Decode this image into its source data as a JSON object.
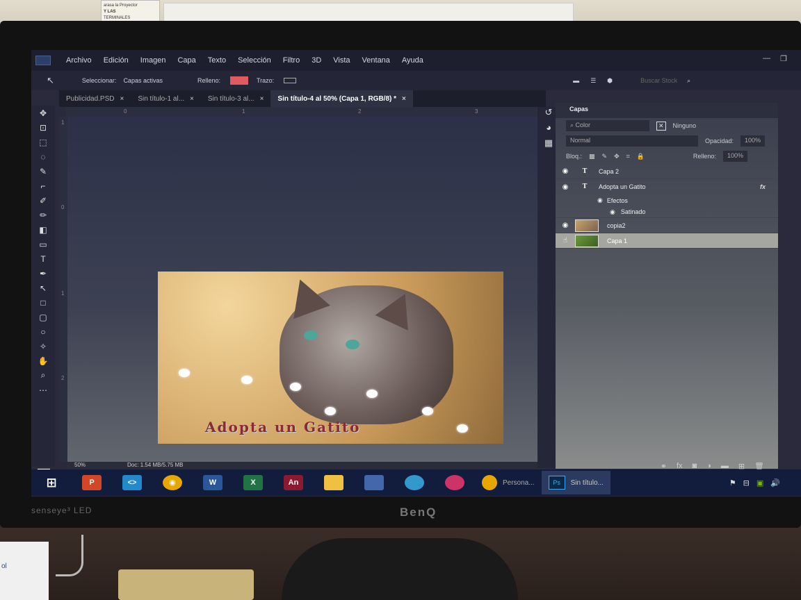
{
  "poster": {
    "line1": "arasa la Proyector",
    "line2": "Y LAS",
    "line3": "TERMINALES"
  },
  "menubar": {
    "items": [
      "Archivo",
      "Edición",
      "Imagen",
      "Capa",
      "Texto",
      "Selección",
      "Filtro",
      "3D",
      "Vista",
      "Ventana",
      "Ayuda"
    ]
  },
  "options": {
    "select_label": "Seleccionar:",
    "select_value": "Capas activas",
    "fill_label": "Relleno:",
    "fill_color": "#e05a60",
    "stroke_label": "Trazo:",
    "search_placeholder": "Buscar Stock"
  },
  "tabs": [
    {
      "label": "Publicidad.PSD"
    },
    {
      "label": "Sin título-1 al..."
    },
    {
      "label": "Sin título-3 al..."
    },
    {
      "label": "Sin título-4 al 50% (Capa 1, RGB/8) *",
      "active": true
    }
  ],
  "close_glyph": "×",
  "ruler": {
    "h": [
      "0",
      "1",
      "2",
      "3"
    ],
    "v": [
      "1",
      "0",
      "1",
      "2"
    ]
  },
  "canvas": {
    "image_text": "Adopta un Gatito"
  },
  "status": {
    "zoom": "50%",
    "doc": "Doc: 1.54 MB/5.75 MB"
  },
  "layers_panel": {
    "title": "Capas",
    "filter_placeholder": "Color",
    "filter_none": "Ninguno",
    "blend_mode": "Normal",
    "opacity_label": "Opacidad:",
    "opacity_value": "100%",
    "lock_label": "Bloq.:",
    "fill_label": "Relleno:",
    "fill_value": "100%",
    "layers": [
      {
        "name": "Capa 2",
        "type": "text"
      },
      {
        "name": "Adopta un Gatito",
        "type": "text",
        "fx": "fx"
      },
      {
        "name": "copia2",
        "type": "image"
      },
      {
        "name": "Capa 1",
        "type": "image",
        "selected": true
      }
    ],
    "effects_label": "Efectos",
    "effect_item": "Satinado"
  },
  "taskbar": {
    "apps": [
      {
        "name": "windows-start",
        "label": "⊞",
        "color": "#1a5fb4"
      },
      {
        "name": "powerpoint",
        "label": "P",
        "color": "#d24726"
      },
      {
        "name": "vscode",
        "label": "<>",
        "color": "#2489ca"
      },
      {
        "name": "chrome",
        "label": "◉",
        "color": "#e8a600"
      },
      {
        "name": "word",
        "label": "W",
        "color": "#2b579a"
      },
      {
        "name": "excel",
        "label": "X",
        "color": "#217346"
      },
      {
        "name": "animate",
        "label": "An",
        "color": "#8b1a2f"
      }
    ],
    "open_windows": [
      "Persona...",
      "Sin título..."
    ]
  },
  "monitor": {
    "brand_left": "senseye³ LED",
    "brand_center": "BenQ"
  }
}
